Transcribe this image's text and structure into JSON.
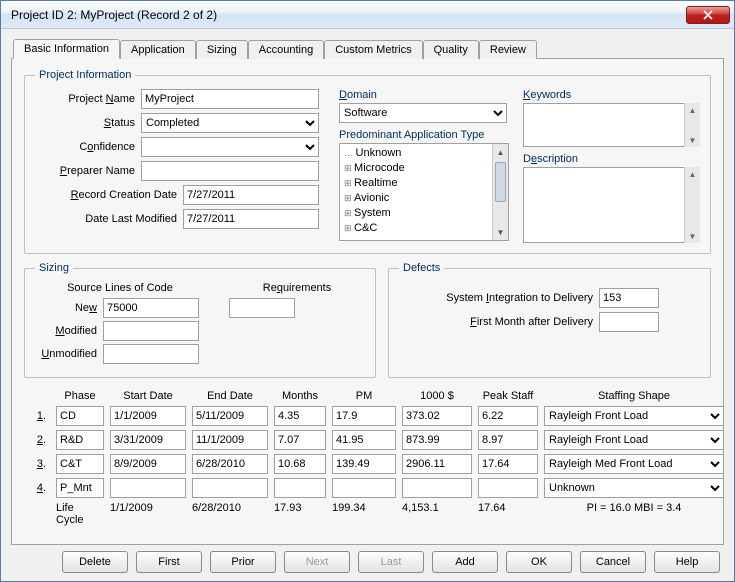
{
  "window": {
    "title": "Project ID 2:   MyProject   (Record 2 of 2)"
  },
  "tabs": [
    "Basic Information",
    "Application",
    "Sizing",
    "Accounting",
    "Custom Metrics",
    "Quality",
    "Review"
  ],
  "projectInfo": {
    "legend": "Project Information",
    "labels": {
      "projectName": "Project Name",
      "status": "Status",
      "confidence": "Confidence",
      "preparerName": "Preparer Name",
      "recordCreation": "Record Creation Date",
      "dateLastModified": "Date Last Modified",
      "domain": "Domain",
      "appType": "Predominant Application Type",
      "keywords": "Keywords",
      "description": "Description"
    },
    "values": {
      "projectName": "MyProject",
      "status": "Completed",
      "confidence": "",
      "preparerName": "",
      "recordCreation": "7/27/2011",
      "dateLastModified": "7/27/2011",
      "domain": "Software",
      "keywords": "",
      "description": ""
    },
    "appTypeTree": [
      "Unknown",
      "Microcode",
      "Realtime",
      "Avionic",
      "System",
      "C&C"
    ]
  },
  "sizing": {
    "legend": "Sizing",
    "slocHeader": "Source Lines of Code",
    "reqHeader": "Requirements",
    "labels": {
      "new": "New",
      "modified": "Modified",
      "unmodified": "Unmodified"
    },
    "values": {
      "new": "75000",
      "modified": "",
      "unmodified": "",
      "requirements": ""
    }
  },
  "defects": {
    "legend": "Defects",
    "labels": {
      "sysInt": "System Integration to Delivery",
      "firstMonth": "First Month after Delivery"
    },
    "values": {
      "sysInt": "153",
      "firstMonth": ""
    }
  },
  "phases": {
    "headers": [
      "",
      "Phase",
      "Start Date",
      "End Date",
      "Months",
      "PM",
      "1000 $",
      "Peak Staff",
      "Staffing Shape"
    ],
    "rows": [
      {
        "n": "1.",
        "phase": "CD",
        "start": "1/1/2009",
        "end": "5/11/2009",
        "months": "4.35",
        "pm": "17.9",
        "cost": "373.02",
        "peak": "6.22",
        "shape": "Rayleigh Front Load"
      },
      {
        "n": "2.",
        "phase": "R&D",
        "start": "3/31/2009",
        "end": "11/1/2009",
        "months": "7.07",
        "pm": "41.95",
        "cost": "873.99",
        "peak": "8.97",
        "shape": "Rayleigh Front Load"
      },
      {
        "n": "3.",
        "phase": "C&T",
        "start": "8/9/2009",
        "end": "6/28/2010",
        "months": "10.68",
        "pm": "139.49",
        "cost": "2906.11",
        "peak": "17.64",
        "shape": "Rayleigh Med Front Load"
      },
      {
        "n": "4.",
        "phase": "P_Mnt",
        "start": "",
        "end": "",
        "months": "",
        "pm": "",
        "cost": "",
        "peak": "",
        "shape": "Unknown"
      }
    ],
    "summary": {
      "label": "Life Cycle",
      "start": "1/1/2009",
      "end": "6/28/2010",
      "months": "17.93",
      "pm": "199.34",
      "cost": "4,153.1",
      "peak": "17.64",
      "extra": "PI = 16.0   MBI = 3.4"
    }
  },
  "buttons": [
    "Delete",
    "First",
    "Prior",
    "Next",
    "Last",
    "Add",
    "OK",
    "Cancel",
    "Help"
  ],
  "disabledButtons": [
    "Next",
    "Last"
  ]
}
